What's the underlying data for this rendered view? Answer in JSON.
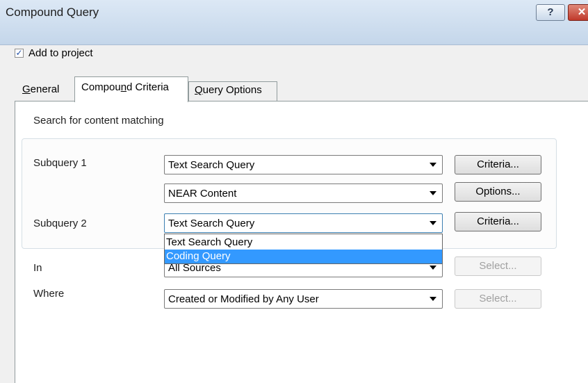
{
  "window": {
    "title": "Compound Query",
    "help_label": "?",
    "close_label": "✕"
  },
  "add_to_project": {
    "label": "Add to project",
    "checked": true,
    "check_glyph": "✓"
  },
  "tabs": [
    {
      "label_pre": "G",
      "label_ul": "",
      "label_post": "eneral",
      "ul_char": "G",
      "active": false
    },
    {
      "label_pre": "Compou",
      "label_ul": "n",
      "label_post": "d Criteria",
      "active": true
    },
    {
      "label_pre": "",
      "label_ul": "Q",
      "label_post": "uery Options",
      "active": false
    }
  ],
  "section_heading": "Search for content matching",
  "subquery1": {
    "label": "Subquery 1",
    "value": "Text Search Query",
    "button": "Criteria..."
  },
  "operator": {
    "value": "NEAR Content",
    "button": "Options..."
  },
  "subquery2": {
    "label": "Subquery 2",
    "value": "Text Search Query",
    "button": "Criteria..."
  },
  "dropdown_options": [
    {
      "label": "Text Search Query",
      "selected": false
    },
    {
      "label": "Coding Query",
      "selected": true
    }
  ],
  "in": {
    "label": "In",
    "value": "All Sources",
    "button": "Select..."
  },
  "where": {
    "label": "Where",
    "value": "Created or Modified by Any User",
    "button": "Select..."
  }
}
